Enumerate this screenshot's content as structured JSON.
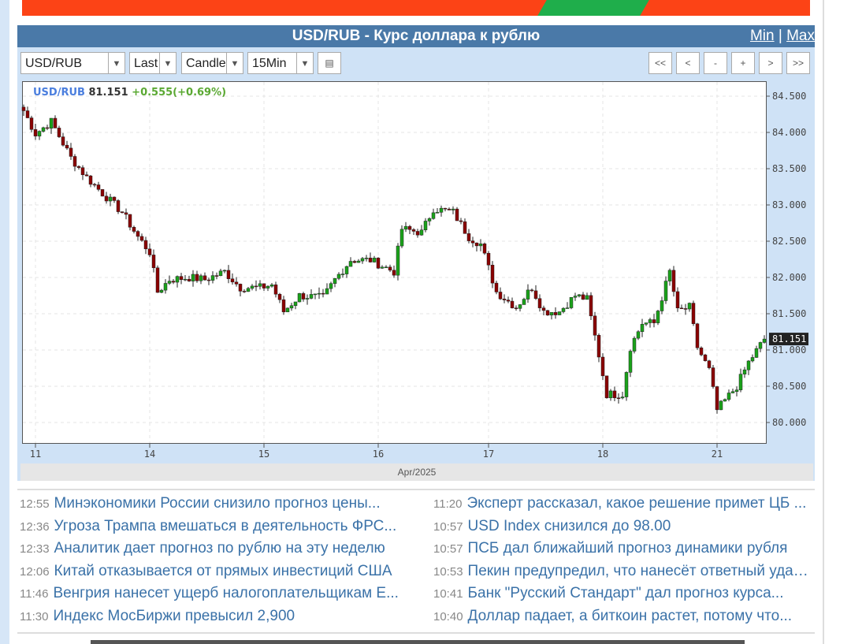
{
  "header": {
    "title": "USD/RUB - Курс доллара к рублю",
    "min": "Min",
    "sep": "|",
    "max": "Max"
  },
  "toolbar": {
    "symbol": "USD/RUB",
    "price_type": "Last",
    "chart_type": "Candle",
    "interval": "15Min",
    "nav": [
      "<<",
      "<",
      "-",
      "+",
      ">",
      ">>"
    ]
  },
  "legend": {
    "symbol": "USD/RUB",
    "price": "81.151",
    "change": "+0.555(+0.69%)"
  },
  "colors": {
    "up": "#1aa21a",
    "down": "#8b0000",
    "accent": "#4a79a8",
    "symbol": "#4a7ede",
    "change": "#5aa832"
  },
  "chart_data": {
    "type": "candlestick",
    "title": "USD/RUB",
    "xlabel": "Apr/2025",
    "x_ticks": [
      {
        "label": "11",
        "bar": 3
      },
      {
        "label": "14",
        "bar": 32
      },
      {
        "label": "15",
        "bar": 61
      },
      {
        "label": "16",
        "bar": 90
      },
      {
        "label": "17",
        "bar": 118
      },
      {
        "label": "18",
        "bar": 147
      },
      {
        "label": "21",
        "bar": 176
      }
    ],
    "y_ticks": [
      "84.500",
      "84.000",
      "83.500",
      "83.000",
      "82.500",
      "82.000",
      "81.500",
      "81.000",
      "80.500",
      "80.000"
    ],
    "ylim": [
      79.7,
      84.7
    ],
    "bars": 189,
    "last": "81.151",
    "path": [
      [
        0,
        84.3
      ],
      [
        3,
        83.98
      ],
      [
        7,
        84.15
      ],
      [
        12,
        83.65
      ],
      [
        16,
        83.38
      ],
      [
        20,
        83.16
      ],
      [
        25,
        82.9
      ],
      [
        29,
        82.56
      ],
      [
        32,
        82.35
      ],
      [
        34,
        81.8
      ],
      [
        37,
        81.97
      ],
      [
        42,
        82.0
      ],
      [
        46,
        81.97
      ],
      [
        51,
        82.08
      ],
      [
        55,
        81.86
      ],
      [
        60,
        81.86
      ],
      [
        63,
        81.9
      ],
      [
        66,
        81.53
      ],
      [
        70,
        81.75
      ],
      [
        76,
        81.72
      ],
      [
        79,
        81.97
      ],
      [
        83,
        82.24
      ],
      [
        88,
        82.24
      ],
      [
        94,
        82.08
      ],
      [
        96,
        82.67
      ],
      [
        101,
        82.62
      ],
      [
        104,
        82.95
      ],
      [
        109,
        82.9
      ],
      [
        113,
        82.56
      ],
      [
        116,
        82.46
      ],
      [
        120,
        81.8
      ],
      [
        125,
        81.59
      ],
      [
        129,
        81.86
      ],
      [
        132,
        81.53
      ],
      [
        136,
        81.53
      ],
      [
        140,
        81.75
      ],
      [
        143,
        81.7
      ],
      [
        146,
        80.93
      ],
      [
        148,
        80.39
      ],
      [
        152,
        80.39
      ],
      [
        154,
        81.04
      ],
      [
        157,
        81.37
      ],
      [
        160,
        81.37
      ],
      [
        164,
        82.08
      ],
      [
        166,
        81.53
      ],
      [
        169,
        81.59
      ],
      [
        171,
        81.04
      ],
      [
        174,
        80.72
      ],
      [
        176,
        80.17
      ],
      [
        181,
        80.5
      ],
      [
        184,
        80.83
      ],
      [
        188,
        81.15
      ]
    ]
  },
  "news": {
    "left": [
      {
        "time": "12:55",
        "text": "Минэкономики России снизило прогноз цены..."
      },
      {
        "time": "12:36",
        "text": "Угроза Трампа вмешаться в деятельность ФРС..."
      },
      {
        "time": "12:33",
        "text": "Аналитик дает прогноз по рублю на эту неделю"
      },
      {
        "time": "12:06",
        "text": "Китай отказывается от прямых инвестиций США"
      },
      {
        "time": "11:46",
        "text": "Венгрия нанесет ущерб налогоплательщикам Е..."
      },
      {
        "time": "11:30",
        "text": "Индекс МосБиржи превысил 2,900"
      }
    ],
    "right": [
      {
        "time": "11:20",
        "text": "Эксперт рассказал, какое решение примет ЦБ ..."
      },
      {
        "time": "10:57",
        "text": "USD Index снизился до 98.00"
      },
      {
        "time": "10:57",
        "text": "ПСБ дал ближайший прогноз динамики рубля"
      },
      {
        "time": "10:53",
        "text": "Пекин предупредил, что нанесёт ответный удар..."
      },
      {
        "time": "10:41",
        "text": "Банк \"Русский Стандарт\" дал прогноз курса..."
      },
      {
        "time": "10:40",
        "text": "Доллар падает, а биткоин растет, потому что..."
      }
    ]
  }
}
